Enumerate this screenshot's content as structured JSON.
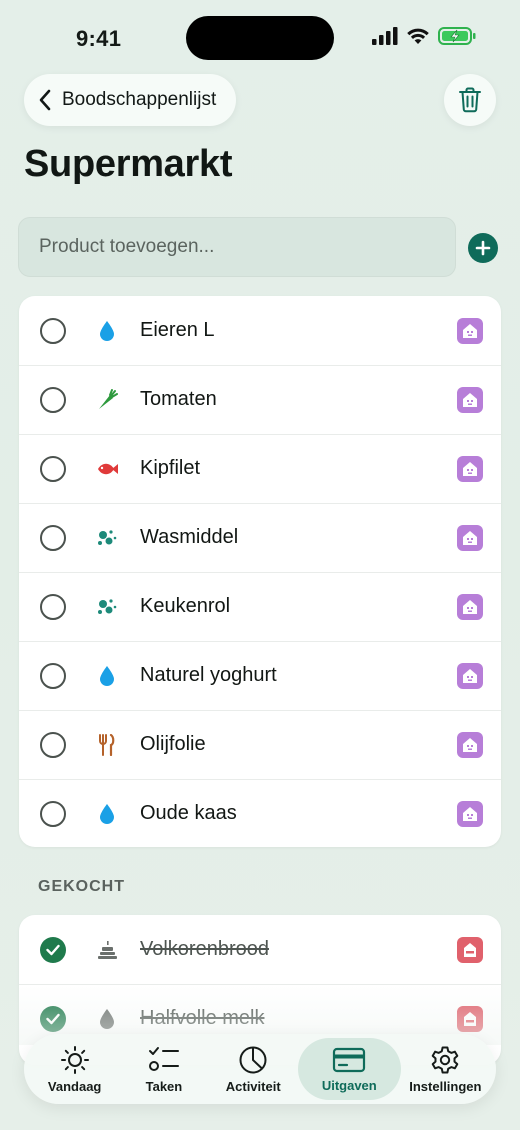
{
  "status_bar": {
    "time": "9:41"
  },
  "header": {
    "back_label": "Boodschappenlijst",
    "title": "Supermarkt"
  },
  "add_row": {
    "placeholder": "Product toevoegen..."
  },
  "open_items": [
    {
      "name": "Eieren L",
      "category_icon": "drop-icon",
      "badge": "house-icon"
    },
    {
      "name": "Tomaten",
      "category_icon": "carrot-icon",
      "badge": "house-icon"
    },
    {
      "name": "Kipfilet",
      "category_icon": "fish-icon",
      "badge": "house-icon"
    },
    {
      "name": "Wasmiddel",
      "category_icon": "bubbles-icon",
      "badge": "house-icon"
    },
    {
      "name": "Keukenrol",
      "category_icon": "bubbles-icon",
      "badge": "house-icon"
    },
    {
      "name": "Naturel yoghurt",
      "category_icon": "drop-icon",
      "badge": "house-icon"
    },
    {
      "name": "Olijfolie",
      "category_icon": "fork-knife-icon",
      "badge": "house-icon"
    },
    {
      "name": "Oude kaas",
      "category_icon": "drop-icon",
      "badge": "house-icon"
    }
  ],
  "bought_section": {
    "label": "GEKOCHT",
    "items": [
      {
        "name": "Volkorenbrood",
        "category_icon": "cake-icon",
        "badge": "house-icon"
      },
      {
        "name": "Halfvolle melk",
        "category_icon": "drop-icon",
        "badge": "house-icon"
      }
    ]
  },
  "tabs": [
    {
      "label": "Vandaag",
      "icon": "sun-icon"
    },
    {
      "label": "Taken",
      "icon": "checklist-icon"
    },
    {
      "label": "Activiteit",
      "icon": "pie-chart-icon"
    },
    {
      "label": "Uitgaven",
      "icon": "card-icon",
      "active": true
    },
    {
      "label": "Instellingen",
      "icon": "gear-icon"
    }
  ],
  "colors": {
    "accent": "#0f6b5a",
    "checked": "#1f7a4c",
    "badge_open": "#b77ed8",
    "badge_bought": "#e0616c",
    "drop": "#1aa0e6",
    "carrot": "#2e9a3e",
    "fish": "#e03a3a",
    "bubbles": "#1d8a7a",
    "fork_knife": "#b5622a"
  }
}
